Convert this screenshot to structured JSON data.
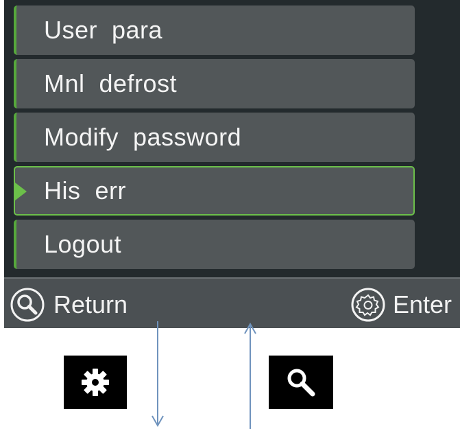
{
  "menu": {
    "items": [
      {
        "label": "User  para",
        "selected": false
      },
      {
        "label": "Mnl  defrost",
        "selected": false
      },
      {
        "label": "Modify  password",
        "selected": false
      },
      {
        "label": "His  err",
        "selected": true
      },
      {
        "label": "Logout",
        "selected": false
      }
    ]
  },
  "bottom_bar": {
    "return_label": "Return",
    "return_icon": "magnifier-icon",
    "enter_label": "Enter",
    "enter_icon": "gear-icon"
  },
  "legend": {
    "gear_icon": "gear-icon",
    "magnifier_icon": "magnifier-icon"
  },
  "colors": {
    "screen_bg": "#232a2d",
    "item_bg": "#525759",
    "accent_green": "#6cc04a",
    "bar_bg": "#4b5053",
    "arrow_blue": "#6f93bd"
  }
}
